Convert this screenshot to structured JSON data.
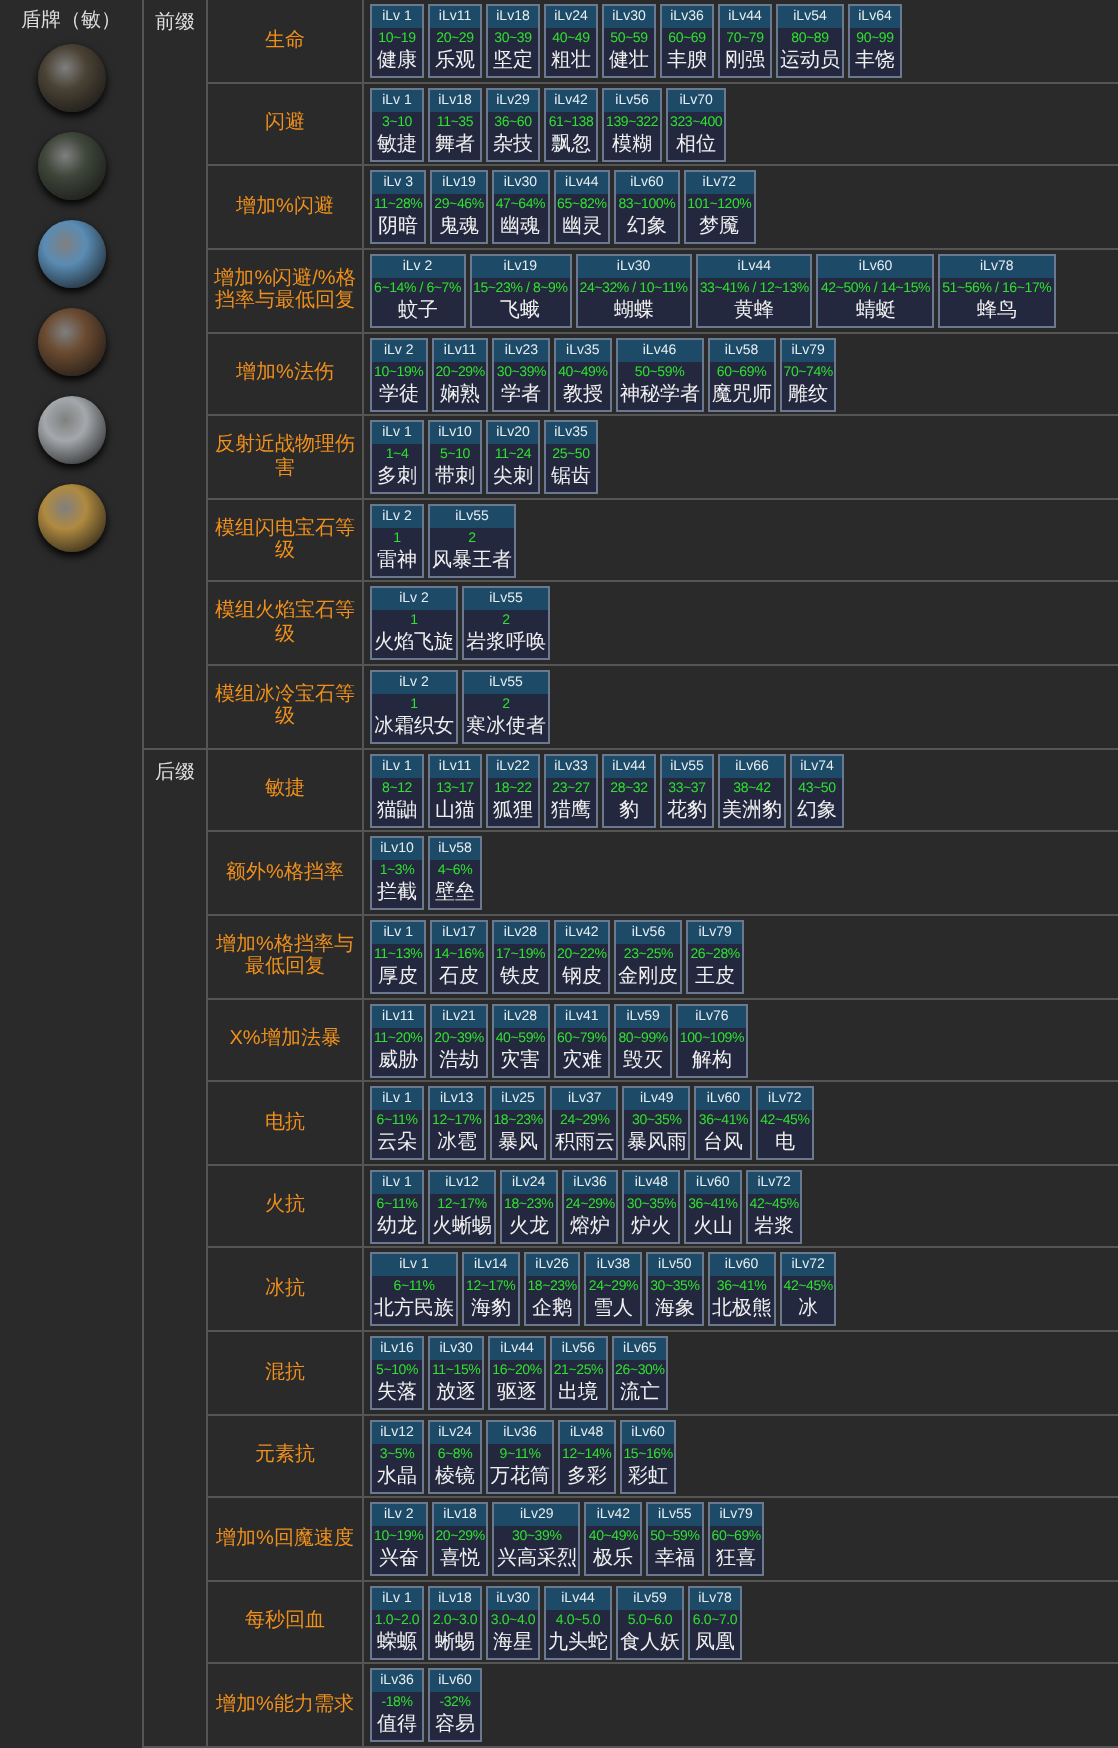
{
  "item_header": "盾牌（敏）",
  "shields": [
    {
      "color": "#4a4234"
    },
    {
      "color": "#3f463a"
    },
    {
      "color": "#5a8cb4"
    },
    {
      "color": "#6a4a30"
    },
    {
      "color": "#a4a8ac"
    },
    {
      "color": "#b08a40"
    }
  ],
  "groups": [
    {
      "label": "前缀",
      "affixes": [
        {
          "name": "生命",
          "tiers": [
            {
              "ilv": "iLv 1",
              "value": "10~19",
              "name": "健康"
            },
            {
              "ilv": "iLv11",
              "value": "20~29",
              "name": "乐观"
            },
            {
              "ilv": "iLv18",
              "value": "30~39",
              "name": "坚定"
            },
            {
              "ilv": "iLv24",
              "value": "40~49",
              "name": "粗壮"
            },
            {
              "ilv": "iLv30",
              "value": "50~59",
              "name": "健壮"
            },
            {
              "ilv": "iLv36",
              "value": "60~69",
              "name": "丰腴"
            },
            {
              "ilv": "iLv44",
              "value": "70~79",
              "name": "刚强"
            },
            {
              "ilv": "iLv54",
              "value": "80~89",
              "name": "运动员"
            },
            {
              "ilv": "iLv64",
              "value": "90~99",
              "name": "丰饶"
            }
          ]
        },
        {
          "name": "闪避",
          "tiers": [
            {
              "ilv": "iLv 1",
              "value": "3~10",
              "name": "敏捷"
            },
            {
              "ilv": "iLv18",
              "value": "11~35",
              "name": "舞者"
            },
            {
              "ilv": "iLv29",
              "value": "36~60",
              "name": "杂技"
            },
            {
              "ilv": "iLv42",
              "value": "61~138",
              "name": "飘忽"
            },
            {
              "ilv": "iLv56",
              "value": "139~322",
              "name": "模糊"
            },
            {
              "ilv": "iLv70",
              "value": "323~400",
              "name": "相位"
            }
          ]
        },
        {
          "name": "增加%闪避",
          "tiers": [
            {
              "ilv": "iLv 3",
              "value": "11~28%",
              "name": "阴暗"
            },
            {
              "ilv": "iLv19",
              "value": "29~46%",
              "name": "鬼魂"
            },
            {
              "ilv": "iLv30",
              "value": "47~64%",
              "name": "幽魂"
            },
            {
              "ilv": "iLv44",
              "value": "65~82%",
              "name": "幽灵"
            },
            {
              "ilv": "iLv60",
              "value": "83~100%",
              "name": "幻象"
            },
            {
              "ilv": "iLv72",
              "value": "101~120%",
              "name": "梦魇"
            }
          ]
        },
        {
          "name": "增加%闪避/%格挡率与最低回复",
          "tiers": [
            {
              "ilv": "iLv 2",
              "value": "6~14% / 6~7%",
              "name": "蚊子"
            },
            {
              "ilv": "iLv19",
              "value": "15~23% / 8~9%",
              "name": "飞蛾"
            },
            {
              "ilv": "iLv30",
              "value": "24~32% / 10~11%",
              "name": "蝴蝶"
            },
            {
              "ilv": "iLv44",
              "value": "33~41% / 12~13%",
              "name": "黄蜂"
            },
            {
              "ilv": "iLv60",
              "value": "42~50% / 14~15%",
              "name": "蜻蜓"
            },
            {
              "ilv": "iLv78",
              "value": "51~56% / 16~17%",
              "name": "蜂鸟"
            }
          ]
        },
        {
          "name": "增加%法伤",
          "tiers": [
            {
              "ilv": "iLv 2",
              "value": "10~19%",
              "name": "学徒"
            },
            {
              "ilv": "iLv11",
              "value": "20~29%",
              "name": "娴熟"
            },
            {
              "ilv": "iLv23",
              "value": "30~39%",
              "name": "学者"
            },
            {
              "ilv": "iLv35",
              "value": "40~49%",
              "name": "教授"
            },
            {
              "ilv": "iLv46",
              "value": "50~59%",
              "name": "神秘学者"
            },
            {
              "ilv": "iLv58",
              "value": "60~69%",
              "name": "魔咒师"
            },
            {
              "ilv": "iLv79",
              "value": "70~74%",
              "name": "雕纹"
            }
          ]
        },
        {
          "name": "反射近战物理伤害",
          "tiers": [
            {
              "ilv": "iLv 1",
              "value": "1~4",
              "name": "多刺"
            },
            {
              "ilv": "iLv10",
              "value": "5~10",
              "name": "带刺"
            },
            {
              "ilv": "iLv20",
              "value": "11~24",
              "name": "尖刺"
            },
            {
              "ilv": "iLv35",
              "value": "25~50",
              "name": "锯齿"
            }
          ]
        },
        {
          "name": "模组闪电宝石等级",
          "tiers": [
            {
              "ilv": "iLv 2",
              "value": "1",
              "name": "雷神"
            },
            {
              "ilv": "iLv55",
              "value": "2",
              "name": "风暴王者"
            }
          ]
        },
        {
          "name": "模组火焰宝石等级",
          "tiers": [
            {
              "ilv": "iLv 2",
              "value": "1",
              "name": "火焰飞旋"
            },
            {
              "ilv": "iLv55",
              "value": "2",
              "name": "岩浆呼唤"
            }
          ]
        },
        {
          "name": "模组冰冷宝石等级",
          "tiers": [
            {
              "ilv": "iLv 2",
              "value": "1",
              "name": "冰霜织女"
            },
            {
              "ilv": "iLv55",
              "value": "2",
              "name": "寒冰使者"
            }
          ]
        }
      ]
    },
    {
      "label": "后缀",
      "affixes": [
        {
          "name": "敏捷",
          "tiers": [
            {
              "ilv": "iLv 1",
              "value": "8~12",
              "name": "猫鼬"
            },
            {
              "ilv": "iLv11",
              "value": "13~17",
              "name": "山猫"
            },
            {
              "ilv": "iLv22",
              "value": "18~22",
              "name": "狐狸"
            },
            {
              "ilv": "iLv33",
              "value": "23~27",
              "name": "猎鹰"
            },
            {
              "ilv": "iLv44",
              "value": "28~32",
              "name": "豹"
            },
            {
              "ilv": "iLv55",
              "value": "33~37",
              "name": "花豹"
            },
            {
              "ilv": "iLv66",
              "value": "38~42",
              "name": "美洲豹"
            },
            {
              "ilv": "iLv74",
              "value": "43~50",
              "name": "幻象"
            }
          ]
        },
        {
          "name": "额外%格挡率",
          "tiers": [
            {
              "ilv": "iLv10",
              "value": "1~3%",
              "name": "拦截"
            },
            {
              "ilv": "iLv58",
              "value": "4~6%",
              "name": "壁垒"
            }
          ]
        },
        {
          "name": "增加%格挡率与最低回复",
          "tiers": [
            {
              "ilv": "iLv 1",
              "value": "11~13%",
              "name": "厚皮"
            },
            {
              "ilv": "iLv17",
              "value": "14~16%",
              "name": "石皮"
            },
            {
              "ilv": "iLv28",
              "value": "17~19%",
              "name": "铁皮"
            },
            {
              "ilv": "iLv42",
              "value": "20~22%",
              "name": "钢皮"
            },
            {
              "ilv": "iLv56",
              "value": "23~25%",
              "name": "金刚皮"
            },
            {
              "ilv": "iLv79",
              "value": "26~28%",
              "name": "王皮"
            }
          ]
        },
        {
          "name": "X%增加法暴",
          "tiers": [
            {
              "ilv": "iLv11",
              "value": "11~20%",
              "name": "威胁"
            },
            {
              "ilv": "iLv21",
              "value": "20~39%",
              "name": "浩劫"
            },
            {
              "ilv": "iLv28",
              "value": "40~59%",
              "name": "灾害"
            },
            {
              "ilv": "iLv41",
              "value": "60~79%",
              "name": "灾难"
            },
            {
              "ilv": "iLv59",
              "value": "80~99%",
              "name": "毁灭"
            },
            {
              "ilv": "iLv76",
              "value": "100~109%",
              "name": "解构"
            }
          ]
        },
        {
          "name": "电抗",
          "tiers": [
            {
              "ilv": "iLv 1",
              "value": "6~11%",
              "name": "云朵"
            },
            {
              "ilv": "iLv13",
              "value": "12~17%",
              "name": "冰雹"
            },
            {
              "ilv": "iLv25",
              "value": "18~23%",
              "name": "暴风"
            },
            {
              "ilv": "iLv37",
              "value": "24~29%",
              "name": "积雨云"
            },
            {
              "ilv": "iLv49",
              "value": "30~35%",
              "name": "暴风雨"
            },
            {
              "ilv": "iLv60",
              "value": "36~41%",
              "name": "台风"
            },
            {
              "ilv": "iLv72",
              "value": "42~45%",
              "name": "电"
            }
          ]
        },
        {
          "name": "火抗",
          "tiers": [
            {
              "ilv": "iLv 1",
              "value": "6~11%",
              "name": "幼龙"
            },
            {
              "ilv": "iLv12",
              "value": "12~17%",
              "name": "火蜥蜴"
            },
            {
              "ilv": "iLv24",
              "value": "18~23%",
              "name": "火龙"
            },
            {
              "ilv": "iLv36",
              "value": "24~29%",
              "name": "熔炉"
            },
            {
              "ilv": "iLv48",
              "value": "30~35%",
              "name": "炉火"
            },
            {
              "ilv": "iLv60",
              "value": "36~41%",
              "name": "火山"
            },
            {
              "ilv": "iLv72",
              "value": "42~45%",
              "name": "岩浆"
            }
          ]
        },
        {
          "name": "冰抗",
          "tiers": [
            {
              "ilv": "iLv 1",
              "value": "6~11%",
              "name": "北方民族"
            },
            {
              "ilv": "iLv14",
              "value": "12~17%",
              "name": "海豹"
            },
            {
              "ilv": "iLv26",
              "value": "18~23%",
              "name": "企鹅"
            },
            {
              "ilv": "iLv38",
              "value": "24~29%",
              "name": "雪人"
            },
            {
              "ilv": "iLv50",
              "value": "30~35%",
              "name": "海象"
            },
            {
              "ilv": "iLv60",
              "value": "36~41%",
              "name": "北极熊"
            },
            {
              "ilv": "iLv72",
              "value": "42~45%",
              "name": "冰"
            }
          ]
        },
        {
          "name": "混抗",
          "tiers": [
            {
              "ilv": "iLv16",
              "value": "5~10%",
              "name": "失落"
            },
            {
              "ilv": "iLv30",
              "value": "11~15%",
              "name": "放逐"
            },
            {
              "ilv": "iLv44",
              "value": "16~20%",
              "name": "驱逐"
            },
            {
              "ilv": "iLv56",
              "value": "21~25%",
              "name": "出境"
            },
            {
              "ilv": "iLv65",
              "value": "26~30%",
              "name": "流亡"
            }
          ]
        },
        {
          "name": "元素抗",
          "tiers": [
            {
              "ilv": "iLv12",
              "value": "3~5%",
              "name": "水晶"
            },
            {
              "ilv": "iLv24",
              "value": "6~8%",
              "name": "棱镜"
            },
            {
              "ilv": "iLv36",
              "value": "9~11%",
              "name": "万花筒"
            },
            {
              "ilv": "iLv48",
              "value": "12~14%",
              "name": "多彩"
            },
            {
              "ilv": "iLv60",
              "value": "15~16%",
              "name": "彩虹"
            }
          ]
        },
        {
          "name": "增加%回魔速度",
          "tiers": [
            {
              "ilv": "iLv 2",
              "value": "10~19%",
              "name": "兴奋"
            },
            {
              "ilv": "iLv18",
              "value": "20~29%",
              "name": "喜悦"
            },
            {
              "ilv": "iLv29",
              "value": "30~39%",
              "name": "兴高采烈"
            },
            {
              "ilv": "iLv42",
              "value": "40~49%",
              "name": "极乐"
            },
            {
              "ilv": "iLv55",
              "value": "50~59%",
              "name": "幸福"
            },
            {
              "ilv": "iLv79",
              "value": "60~69%",
              "name": "狂喜"
            }
          ]
        },
        {
          "name": "每秒回血",
          "tiers": [
            {
              "ilv": "iLv 1",
              "value": "1.0~2.0",
              "name": "蝾螈"
            },
            {
              "ilv": "iLv18",
              "value": "2.0~3.0",
              "name": "蜥蜴"
            },
            {
              "ilv": "iLv30",
              "value": "3.0~4.0",
              "name": "海星"
            },
            {
              "ilv": "iLv44",
              "value": "4.0~5.0",
              "name": "九头蛇"
            },
            {
              "ilv": "iLv59",
              "value": "5.0~6.0",
              "name": "食人妖"
            },
            {
              "ilv": "iLv78",
              "value": "6.0~7.0",
              "name": "凤凰"
            }
          ]
        },
        {
          "name": "增加%能力需求",
          "tiers": [
            {
              "ilv": "iLv36",
              "value": "-18%",
              "name": "值得"
            },
            {
              "ilv": "iLv60",
              "value": "-32%",
              "name": "容易"
            }
          ]
        }
      ]
    }
  ]
}
